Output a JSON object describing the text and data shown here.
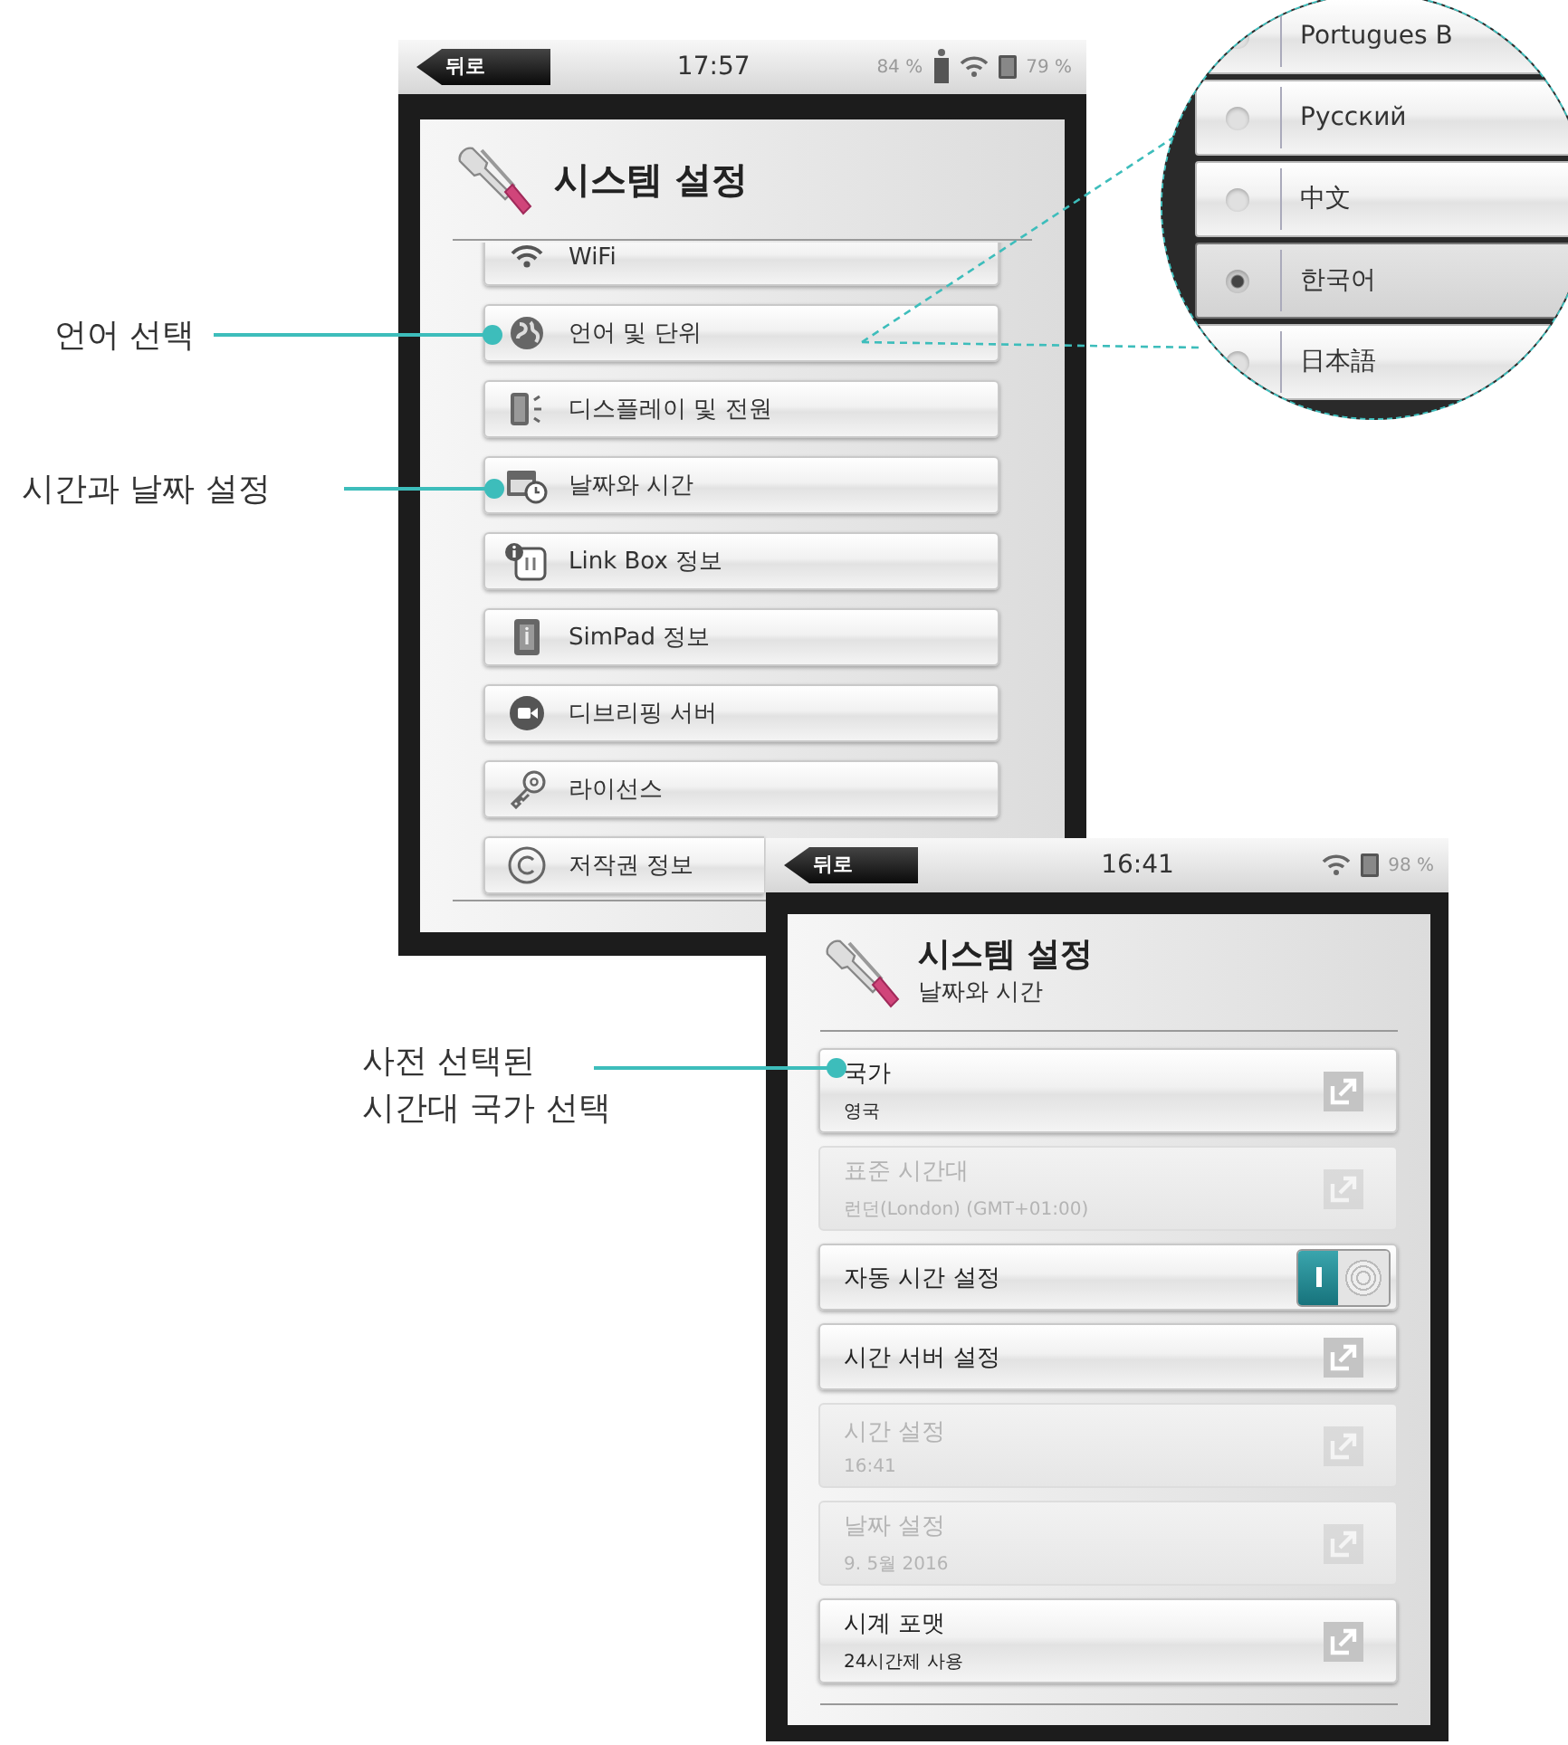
{
  "callouts": [
    {
      "text": "언어 선택"
    },
    {
      "text": "시간과 날짜 설정"
    },
    {
      "text": "사전 선택된\n시간대 국가 선택"
    }
  ],
  "screen_1": {
    "status_bar": {
      "back": "뒤로",
      "time": "17:57",
      "link_battery": "84 %",
      "battery": "79 %"
    },
    "title": "시스템 설정",
    "menu": [
      {
        "kind": "wifi",
        "label": "WiFi"
      },
      {
        "kind": "globe",
        "label": "언어 및 단위"
      },
      {
        "kind": "display",
        "label": "디스플레이 및 전원"
      },
      {
        "kind": "calendar",
        "label": "날짜와 시간"
      },
      {
        "kind": "linkbox",
        "label": "Link Box 정보"
      },
      {
        "kind": "simpad",
        "label": "SimPad 정보"
      },
      {
        "kind": "camera",
        "label": "디브리핑 서버"
      },
      {
        "kind": "key",
        "label": "라이선스"
      },
      {
        "kind": "copyright",
        "label": "저작권 정보"
      }
    ]
  },
  "magnifier": {
    "languages": [
      {
        "label": "Portugues B",
        "selected": false
      },
      {
        "label": "Русский",
        "selected": false
      },
      {
        "label": "中文",
        "selected": false
      },
      {
        "label": "한국어",
        "selected": true
      },
      {
        "label": "日本語",
        "selected": false
      }
    ]
  },
  "screen_2": {
    "status_bar": {
      "back": "뒤로",
      "time": "16:41",
      "battery": "98 %"
    },
    "title": "시스템 설정",
    "subtitle": "날짜와 시간",
    "settings": [
      {
        "kind": "link",
        "label": "국가",
        "value": "영국",
        "disabled": false
      },
      {
        "kind": "link",
        "label": "표준 시간대",
        "value": "런던(London) (GMT+01:00)",
        "disabled": true
      },
      {
        "kind": "toggle",
        "label": "자동 시간 설정",
        "on": true
      },
      {
        "kind": "link",
        "label": "시간 서버 설정",
        "disabled": false
      },
      {
        "kind": "link",
        "label": "시간 설정",
        "value": "16:41",
        "disabled": true
      },
      {
        "kind": "link",
        "label": "날짜 설정",
        "value": "9. 5월 2016",
        "disabled": true
      },
      {
        "kind": "link",
        "label": "시계 포맷",
        "value": "24시간제 사용",
        "disabled": false
      }
    ]
  }
}
